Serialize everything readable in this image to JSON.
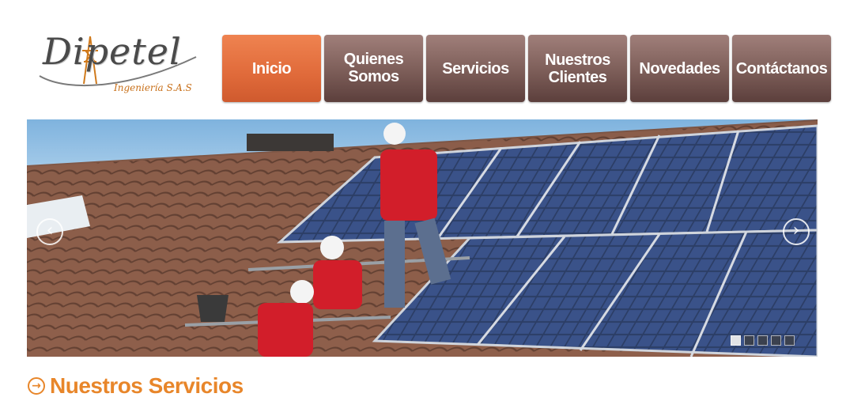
{
  "logo": {
    "name": "Dipetel",
    "subtitle": "Ingeniería S.A.S"
  },
  "nav": {
    "items": [
      {
        "label": "Inicio",
        "active": true
      },
      {
        "label": "Quienes Somos",
        "active": false
      },
      {
        "label": "Servicios",
        "active": false
      },
      {
        "label": "Nuestros\nClientes",
        "active": false
      },
      {
        "label": "Novedades",
        "active": false
      },
      {
        "label": "Contáctanos",
        "active": false
      }
    ]
  },
  "slider": {
    "prev_icon": "chevron-left-icon",
    "next_icon": "chevron-right-icon",
    "slide_count": 5,
    "active_slide": 1
  },
  "section": {
    "title": "Nuestros Servicios",
    "icon": "circle-arrow-right-icon"
  },
  "colors": {
    "accent": "#e8862a",
    "nav_active": "#e06a3a",
    "nav_default": "#7c5d58"
  }
}
